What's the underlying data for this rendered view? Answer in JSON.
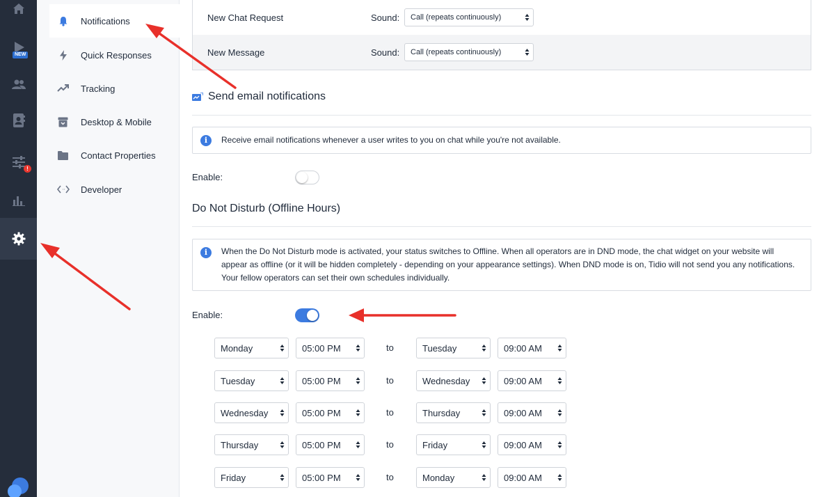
{
  "rail": {
    "new_badge": "NEW",
    "alert_badge": "!",
    "items": [
      {
        "icon": "home-icon"
      },
      {
        "icon": "play-icon"
      },
      {
        "icon": "users-icon"
      },
      {
        "icon": "contacts-icon"
      },
      {
        "icon": "sliders-icon"
      },
      {
        "icon": "analytics-icon"
      },
      {
        "icon": "gear-icon"
      }
    ]
  },
  "submenu": {
    "items": [
      {
        "label": "Notifications",
        "icon": "bell-icon",
        "active": true
      },
      {
        "label": "Quick Responses",
        "icon": "lightning-icon"
      },
      {
        "label": "Tracking",
        "icon": "trend-icon"
      },
      {
        "label": "Desktop & Mobile",
        "icon": "archive-icon"
      },
      {
        "label": "Contact Properties",
        "icon": "folder-icon"
      },
      {
        "label": "Developer",
        "icon": "code-icon"
      }
    ]
  },
  "sound_rows": [
    {
      "name": "New Chat Request",
      "sound_label": "Sound:",
      "value": "Call (repeats continuously)"
    },
    {
      "name": "New Message",
      "sound_label": "Sound:",
      "value": "Call (repeats continuously)"
    }
  ],
  "email_section": {
    "title": "Send email notifications",
    "info": "Receive email notifications whenever a user writes to you on chat while you're not available.",
    "enable_label": "Enable:",
    "enabled": false
  },
  "dnd_section": {
    "title": "Do Not Disturb (Offline Hours)",
    "info": "When the Do Not Disturb mode is activated, your status switches to Offline. When all operators are in DND mode, the chat widget on your website will appear as offline (or it will be hidden completely - depending on your appearance settings). When DND mode is on, Tidio will not send you any notifications. Your fellow operators can set their own schedules individually.",
    "enable_label": "Enable:",
    "enabled": true,
    "to_label": "to",
    "schedule": [
      {
        "from_day": "Monday",
        "from_time": "05:00 PM",
        "to_day": "Tuesday",
        "to_time": "09:00 AM"
      },
      {
        "from_day": "Tuesday",
        "from_time": "05:00 PM",
        "to_day": "Wednesday",
        "to_time": "09:00 AM"
      },
      {
        "from_day": "Wednesday",
        "from_time": "05:00 PM",
        "to_day": "Thursday",
        "to_time": "09:00 AM"
      },
      {
        "from_day": "Thursday",
        "from_time": "05:00 PM",
        "to_day": "Friday",
        "to_time": "09:00 AM"
      },
      {
        "from_day": "Friday",
        "from_time": "05:00 PM",
        "to_day": "Monday",
        "to_time": "09:00 AM"
      }
    ]
  },
  "colors": {
    "rail": "#252d3b",
    "accent": "#3c7be0",
    "annotation_arrow": "#e8302a"
  }
}
